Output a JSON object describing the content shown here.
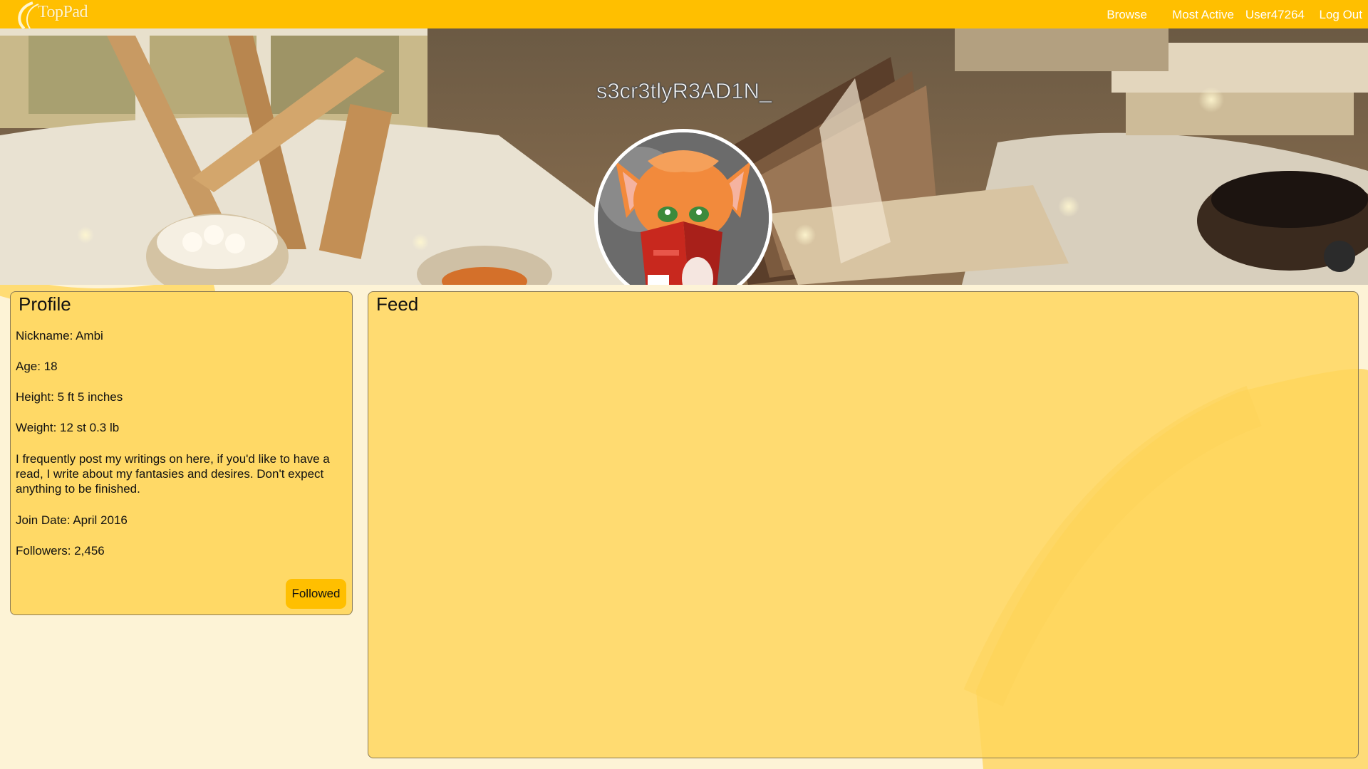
{
  "app": {
    "logo_text": "TopPad"
  },
  "nav": {
    "browse": "Browse",
    "most_active": "Most Active",
    "user": "User47264",
    "logout": "Log Out"
  },
  "profile_header": {
    "username": "s3cr3tlyR3AD1N_"
  },
  "profile": {
    "title": "Profile",
    "nickname": "Nickname: Ambi",
    "age": "Age: 18",
    "height": "Height: 5 ft 5 inches",
    "weight": "Weight: 12 st 0.3 lb",
    "bio": "I frequently post my writings on here, if you'd like to have a read, I write about my fantasies and desires. Don't expect anything to be finished.",
    "join_date": "Join Date: April 2016",
    "followers": "Followers: 2,456",
    "follow_button": "Followed"
  },
  "feed": {
    "title": "Feed"
  },
  "colors": {
    "accent": "#ffbf00",
    "panel": "#ffd966",
    "page_bg": "#fdf3d6"
  }
}
